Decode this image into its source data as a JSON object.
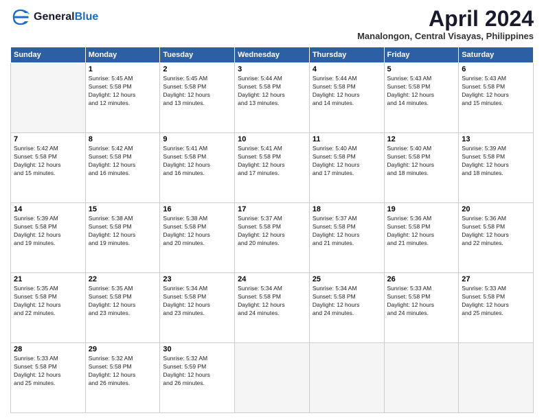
{
  "logo": {
    "line1": "General",
    "line2": "Blue"
  },
  "title": "April 2024",
  "location": "Manalongon, Central Visayas, Philippines",
  "days_of_week": [
    "Sunday",
    "Monday",
    "Tuesday",
    "Wednesday",
    "Thursday",
    "Friday",
    "Saturday"
  ],
  "weeks": [
    [
      {
        "day": "",
        "empty": true
      },
      {
        "day": "1",
        "sunrise": "5:45 AM",
        "sunset": "5:58 PM",
        "daylight": "12 hours and 12 minutes."
      },
      {
        "day": "2",
        "sunrise": "5:45 AM",
        "sunset": "5:58 PM",
        "daylight": "12 hours and 13 minutes."
      },
      {
        "day": "3",
        "sunrise": "5:44 AM",
        "sunset": "5:58 PM",
        "daylight": "12 hours and 13 minutes."
      },
      {
        "day": "4",
        "sunrise": "5:44 AM",
        "sunset": "5:58 PM",
        "daylight": "12 hours and 14 minutes."
      },
      {
        "day": "5",
        "sunrise": "5:43 AM",
        "sunset": "5:58 PM",
        "daylight": "12 hours and 14 minutes."
      },
      {
        "day": "6",
        "sunrise": "5:43 AM",
        "sunset": "5:58 PM",
        "daylight": "12 hours and 15 minutes."
      }
    ],
    [
      {
        "day": "7",
        "sunrise": "5:42 AM",
        "sunset": "5:58 PM",
        "daylight": "12 hours and 15 minutes."
      },
      {
        "day": "8",
        "sunrise": "5:42 AM",
        "sunset": "5:58 PM",
        "daylight": "12 hours and 16 minutes."
      },
      {
        "day": "9",
        "sunrise": "5:41 AM",
        "sunset": "5:58 PM",
        "daylight": "12 hours and 16 minutes."
      },
      {
        "day": "10",
        "sunrise": "5:41 AM",
        "sunset": "5:58 PM",
        "daylight": "12 hours and 17 minutes."
      },
      {
        "day": "11",
        "sunrise": "5:40 AM",
        "sunset": "5:58 PM",
        "daylight": "12 hours and 17 minutes."
      },
      {
        "day": "12",
        "sunrise": "5:40 AM",
        "sunset": "5:58 PM",
        "daylight": "12 hours and 18 minutes."
      },
      {
        "day": "13",
        "sunrise": "5:39 AM",
        "sunset": "5:58 PM",
        "daylight": "12 hours and 18 minutes."
      }
    ],
    [
      {
        "day": "14",
        "sunrise": "5:39 AM",
        "sunset": "5:58 PM",
        "daylight": "12 hours and 19 minutes."
      },
      {
        "day": "15",
        "sunrise": "5:38 AM",
        "sunset": "5:58 PM",
        "daylight": "12 hours and 19 minutes."
      },
      {
        "day": "16",
        "sunrise": "5:38 AM",
        "sunset": "5:58 PM",
        "daylight": "12 hours and 20 minutes."
      },
      {
        "day": "17",
        "sunrise": "5:37 AM",
        "sunset": "5:58 PM",
        "daylight": "12 hours and 20 minutes."
      },
      {
        "day": "18",
        "sunrise": "5:37 AM",
        "sunset": "5:58 PM",
        "daylight": "12 hours and 21 minutes."
      },
      {
        "day": "19",
        "sunrise": "5:36 AM",
        "sunset": "5:58 PM",
        "daylight": "12 hours and 21 minutes."
      },
      {
        "day": "20",
        "sunrise": "5:36 AM",
        "sunset": "5:58 PM",
        "daylight": "12 hours and 22 minutes."
      }
    ],
    [
      {
        "day": "21",
        "sunrise": "5:35 AM",
        "sunset": "5:58 PM",
        "daylight": "12 hours and 22 minutes."
      },
      {
        "day": "22",
        "sunrise": "5:35 AM",
        "sunset": "5:58 PM",
        "daylight": "12 hours and 23 minutes."
      },
      {
        "day": "23",
        "sunrise": "5:34 AM",
        "sunset": "5:58 PM",
        "daylight": "12 hours and 23 minutes."
      },
      {
        "day": "24",
        "sunrise": "5:34 AM",
        "sunset": "5:58 PM",
        "daylight": "12 hours and 24 minutes."
      },
      {
        "day": "25",
        "sunrise": "5:34 AM",
        "sunset": "5:58 PM",
        "daylight": "12 hours and 24 minutes."
      },
      {
        "day": "26",
        "sunrise": "5:33 AM",
        "sunset": "5:58 PM",
        "daylight": "12 hours and 24 minutes."
      },
      {
        "day": "27",
        "sunrise": "5:33 AM",
        "sunset": "5:58 PM",
        "daylight": "12 hours and 25 minutes."
      }
    ],
    [
      {
        "day": "28",
        "sunrise": "5:33 AM",
        "sunset": "5:58 PM",
        "daylight": "12 hours and 25 minutes."
      },
      {
        "day": "29",
        "sunrise": "5:32 AM",
        "sunset": "5:58 PM",
        "daylight": "12 hours and 26 minutes."
      },
      {
        "day": "30",
        "sunrise": "5:32 AM",
        "sunset": "5:59 PM",
        "daylight": "12 hours and 26 minutes."
      },
      {
        "day": "",
        "empty": true
      },
      {
        "day": "",
        "empty": true
      },
      {
        "day": "",
        "empty": true
      },
      {
        "day": "",
        "empty": true
      }
    ]
  ],
  "labels": {
    "sunrise": "Sunrise:",
    "sunset": "Sunset:",
    "daylight": "Daylight:"
  }
}
